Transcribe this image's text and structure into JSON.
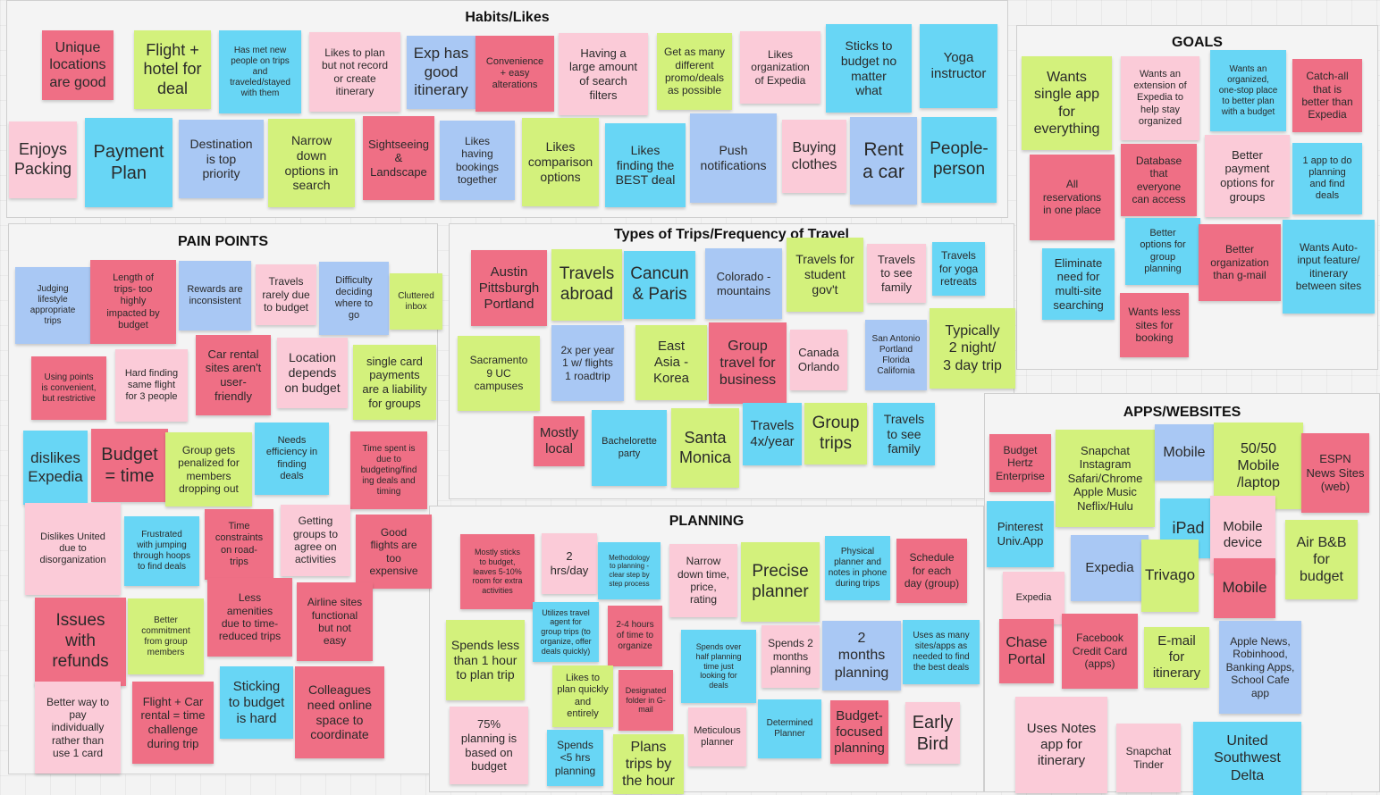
{
  "colors": {
    "red": "#ef6f85",
    "pink": "#fbcbd8",
    "green": "#d3f17c",
    "blue": "#68d6f5",
    "lightblue": "#a9c8f4",
    "frame_bg": "#f4f4f4",
    "canvas_bg": "#f3f3f3"
  },
  "frames": [
    {
      "id": "habits",
      "title": "Habits/Likes"
    },
    {
      "id": "goals",
      "title": "GOALS"
    },
    {
      "id": "pain",
      "title": "PAIN POINTS"
    },
    {
      "id": "trips",
      "title": "Types of Trips/Frequency of Travel"
    },
    {
      "id": "apps",
      "title": "APPS/WEBSITES"
    },
    {
      "id": "planning",
      "title": "PLANNING"
    }
  ],
  "notes": {
    "habits": [
      {
        "text": "Unique\nlocations\nare good",
        "color": "red"
      },
      {
        "text": "Flight +\nhotel for\ndeal",
        "color": "green"
      },
      {
        "text": "Has met new\npeople on trips\nand\ntraveled/stayed\nwith them",
        "color": "blue"
      },
      {
        "text": "Likes to plan\nbut not record\nor create\nitinerary",
        "color": "pink"
      },
      {
        "text": "Exp has\ngood\nitinerary",
        "color": "lightblue"
      },
      {
        "text": "Convenience\n+ easy\nalterations",
        "color": "red"
      },
      {
        "text": "Having a\nlarge amount\nof search\nfilters",
        "color": "pink"
      },
      {
        "text": "Get as many\ndifferent\npromo/deals\nas possible",
        "color": "green"
      },
      {
        "text": "Likes\norganization\nof Expedia",
        "color": "pink"
      },
      {
        "text": "Sticks to\nbudget no\nmatter\nwhat",
        "color": "blue"
      },
      {
        "text": "Yoga\ninstructor",
        "color": "blue"
      },
      {
        "text": "Enjoys\nPacking",
        "color": "pink"
      },
      {
        "text": "Payment\nPlan",
        "color": "blue"
      },
      {
        "text": "Destination\nis top\npriority",
        "color": "lightblue"
      },
      {
        "text": "Narrow\ndown\noptions in\nsearch",
        "color": "green"
      },
      {
        "text": "Sightseeing\n&\nLandscape",
        "color": "red"
      },
      {
        "text": "Likes\nhaving\nbookings\ntogether",
        "color": "lightblue"
      },
      {
        "text": "Likes\ncomparison\noptions",
        "color": "green"
      },
      {
        "text": "Likes\nfinding the\nBEST deal",
        "color": "blue"
      },
      {
        "text": "Push\nnotifications",
        "color": "lightblue"
      },
      {
        "text": "Buying\nclothes",
        "color": "pink"
      },
      {
        "text": "Rent\na car",
        "color": "lightblue"
      },
      {
        "text": "People-\nperson",
        "color": "blue"
      }
    ],
    "goals": [
      {
        "text": "Wants\nsingle app\nfor\neverything",
        "color": "green"
      },
      {
        "text": "Wants an\nextension of\nExpedia to\nhelp stay\norganized",
        "color": "pink"
      },
      {
        "text": "Wants an\norganized,\none-stop place\nto better plan\nwith a budget",
        "color": "blue"
      },
      {
        "text": "Catch-all\nthat is\nbetter than\nExpedia",
        "color": "red"
      },
      {
        "text": "All\nreservations\nin one place",
        "color": "red"
      },
      {
        "text": "Database\nthat\neveryone\ncan access",
        "color": "red"
      },
      {
        "text": "Better\npayment\noptions for\ngroups",
        "color": "pink"
      },
      {
        "text": "1 app to do\nplanning\nand find\ndeals",
        "color": "blue"
      },
      {
        "text": "Eliminate\nneed for\nmulti-site\nsearching",
        "color": "blue"
      },
      {
        "text": "Better\noptions for\ngroup\nplanning",
        "color": "blue"
      },
      {
        "text": "Better\norganization\nthan g-mail",
        "color": "red"
      },
      {
        "text": "Wants Auto-\ninput feature/\nitinerary\nbetween sites",
        "color": "blue"
      },
      {
        "text": "Wants less\nsites for\nbooking",
        "color": "red"
      }
    ],
    "pain": [
      {
        "text": "Judging\nlifestyle\nappropriate\ntrips",
        "color": "lightblue"
      },
      {
        "text": "Length of\ntrips- too\nhighly\nimpacted by\nbudget",
        "color": "red"
      },
      {
        "text": "Rewards are\ninconsistent",
        "color": "lightblue"
      },
      {
        "text": "Travels\nrarely due\nto budget",
        "color": "pink"
      },
      {
        "text": "Difficulty\ndeciding\nwhere to\ngo",
        "color": "lightblue"
      },
      {
        "text": "Cluttered\ninbox",
        "color": "green"
      },
      {
        "text": "Using points\nis convenient,\nbut restrictive",
        "color": "red"
      },
      {
        "text": "Hard finding\nsame flight\nfor 3 people",
        "color": "pink"
      },
      {
        "text": "Car rental\nsites aren't\nuser-\nfriendly",
        "color": "red"
      },
      {
        "text": "Location\ndepends\non budget",
        "color": "pink"
      },
      {
        "text": "single card\npayments\nare a liability\nfor groups",
        "color": "green"
      },
      {
        "text": "dislikes\nExpedia",
        "color": "blue"
      },
      {
        "text": "Budget\n= time",
        "color": "red"
      },
      {
        "text": "Group gets\npenalized for\nmembers\ndropping out",
        "color": "green"
      },
      {
        "text": "Needs\nefficiency in\nfinding\ndeals",
        "color": "blue"
      },
      {
        "text": "Time spent is\ndue to\nbudgeting/find\ning deals and\ntiming",
        "color": "red"
      },
      {
        "text": "Dislikes United\ndue to\ndisorganization",
        "color": "pink"
      },
      {
        "text": "Frustrated\nwith jumping\nthrough hoops\nto find deals",
        "color": "blue"
      },
      {
        "text": "Time\nconstraints\non road-\ntrips",
        "color": "red"
      },
      {
        "text": "Getting\ngroups to\nagree on\nactivities",
        "color": "pink"
      },
      {
        "text": "Good\nflights are\ntoo\nexpensive",
        "color": "red"
      },
      {
        "text": "Issues\nwith\nrefunds",
        "color": "red"
      },
      {
        "text": "Better\ncommitment\nfrom group\nmembers",
        "color": "green"
      },
      {
        "text": "Less\namenities\ndue to time-\nreduced trips",
        "color": "red"
      },
      {
        "text": "Airline sites\nfunctional\nbut not\neasy",
        "color": "red"
      },
      {
        "text": "Better way to\npay\nindividually\nrather than\nuse 1 card",
        "color": "pink"
      },
      {
        "text": "Flight + Car\nrental = time\nchallenge\nduring trip",
        "color": "red"
      },
      {
        "text": "Sticking\nto budget\nis hard",
        "color": "blue"
      },
      {
        "text": "Colleagues\nneed online\nspace to\ncoordinate",
        "color": "red"
      }
    ],
    "trips": [
      {
        "text": "Austin\nPittsburgh\nPortland",
        "color": "red"
      },
      {
        "text": "Travels\nabroad",
        "color": "green"
      },
      {
        "text": "Cancun\n& Paris",
        "color": "blue"
      },
      {
        "text": "Colorado -\nmountains",
        "color": "lightblue"
      },
      {
        "text": "Travels for\nstudent\ngov't",
        "color": "green"
      },
      {
        "text": "Travels\nto see\nfamily",
        "color": "pink"
      },
      {
        "text": "Travels\nfor yoga\nretreats",
        "color": "blue"
      },
      {
        "text": "Sacramento\n9 UC\ncampuses",
        "color": "green"
      },
      {
        "text": "2x per year\n1 w/ flights\n1 roadtrip",
        "color": "lightblue"
      },
      {
        "text": "East\nAsia -\nKorea",
        "color": "green"
      },
      {
        "text": "Group\ntravel for\nbusiness",
        "color": "red"
      },
      {
        "text": "Canada\nOrlando",
        "color": "pink"
      },
      {
        "text": "San Antonio\nPortland\nFlorida\nCalifornia",
        "color": "lightblue"
      },
      {
        "text": "Typically\n2 night/\n3 day trip",
        "color": "green"
      },
      {
        "text": "Mostly\nlocal",
        "color": "red"
      },
      {
        "text": "Bachelorette\nparty",
        "color": "blue"
      },
      {
        "text": "Santa\nMonica",
        "color": "green"
      },
      {
        "text": "Travels\n4x/year",
        "color": "blue"
      },
      {
        "text": "Group\ntrips",
        "color": "green"
      },
      {
        "text": "Travels\nto see\nfamily",
        "color": "blue"
      }
    ],
    "apps": [
      {
        "text": "Budget\nHertz\nEnterprise",
        "color": "red"
      },
      {
        "text": "Snapchat\nInstagram\nSafari/Chrome\nApple Music\nNeflix/Hulu",
        "color": "green"
      },
      {
        "text": "Mobile",
        "color": "lightblue"
      },
      {
        "text": "50/50\nMobile\n/laptop",
        "color": "green"
      },
      {
        "text": "ESPN\nNews Sites\n(web)",
        "color": "red"
      },
      {
        "text": "Pinterest\nUniv.App",
        "color": "blue"
      },
      {
        "text": "iPad",
        "color": "blue"
      },
      {
        "text": "Mobile\ndevice",
        "color": "pink"
      },
      {
        "text": "Expedia",
        "color": "lightblue"
      },
      {
        "text": "Trivago",
        "color": "green"
      },
      {
        "text": "Mobile",
        "color": "red"
      },
      {
        "text": "Air B&B\nfor\nbudget",
        "color": "green"
      },
      {
        "text": "Expedia",
        "color": "pink"
      },
      {
        "text": "Chase\nPortal",
        "color": "red"
      },
      {
        "text": "Facebook\nCredit Card\n(apps)",
        "color": "red"
      },
      {
        "text": "E-mail\nfor\nitinerary",
        "color": "green"
      },
      {
        "text": "Apple News,\nRobinhood,\nBanking Apps,\nSchool Cafe\napp",
        "color": "lightblue"
      },
      {
        "text": "Uses Notes\napp for\nitinerary",
        "color": "pink"
      },
      {
        "text": "Snapchat\nTinder",
        "color": "pink"
      },
      {
        "text": "United\nSouthwest\nDelta",
        "color": "blue"
      }
    ],
    "planning": [
      {
        "text": "Mostly sticks\nto budget,\nleaves 5-10%\nroom for extra\nactivities",
        "color": "red"
      },
      {
        "text": "2\nhrs/day",
        "color": "pink"
      },
      {
        "text": "Methodology\nto planning -\nclear step by\nstep process",
        "color": "blue"
      },
      {
        "text": "Narrow\ndown time,\nprice,\nrating",
        "color": "pink"
      },
      {
        "text": "Precise\nplanner",
        "color": "green"
      },
      {
        "text": "Physical\nplanner and\nnotes in phone\nduring trips",
        "color": "blue"
      },
      {
        "text": "Schedule\nfor each\nday (group)",
        "color": "red"
      },
      {
        "text": "Spends less\nthan 1 hour\nto plan trip",
        "color": "green"
      },
      {
        "text": "Utilizes travel\nagent for\ngroup trips (to\norganize, offer\ndeals quickly)",
        "color": "blue"
      },
      {
        "text": "2-4 hours\nof time to\norganize",
        "color": "red"
      },
      {
        "text": "Spends over\nhalf planning\ntime just\nlooking for\ndeals",
        "color": "blue"
      },
      {
        "text": "Spends 2\nmonths\nplanning",
        "color": "pink"
      },
      {
        "text": "2\nmonths\nplanning",
        "color": "lightblue"
      },
      {
        "text": "Uses as many\nsites/apps as\nneeded to find\nthe best deals",
        "color": "blue"
      },
      {
        "text": "Likes to\nplan quickly\nand\nentirely",
        "color": "green"
      },
      {
        "text": "Designated\nfolder in G-\nmail",
        "color": "red"
      },
      {
        "text": "75%\nplanning is\nbased on\nbudget",
        "color": "pink"
      },
      {
        "text": "Spends\n<5 hrs\nplanning",
        "color": "blue"
      },
      {
        "text": "Plans\ntrips by\nthe hour",
        "color": "green"
      },
      {
        "text": "Meticulous\nplanner",
        "color": "pink"
      },
      {
        "text": "Determined\nPlanner",
        "color": "blue"
      },
      {
        "text": "Budget-\nfocused\nplanning",
        "color": "red"
      },
      {
        "text": "Early\nBird",
        "color": "pink"
      }
    ]
  }
}
